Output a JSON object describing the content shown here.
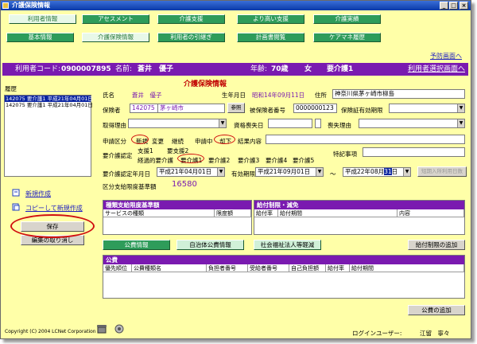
{
  "window": {
    "title": "介護保険情報"
  },
  "nav_row1": [
    "利用者情報",
    "アセスメント",
    "介護支援",
    "より高い支援",
    "介護実績"
  ],
  "nav_row2": [
    "基本情報",
    "介護保険情報",
    "利用者の引継ぎ",
    "計画書閲覧",
    "ケアマネ履歴"
  ],
  "links": {
    "prev_screen": "予防画面へ",
    "user_select": "利用者選択画面へ",
    "new_create": "新規作成",
    "copy_create": "コピーして新規作成"
  },
  "userbar": {
    "code_label": "利用者コード:",
    "code": "0900007895",
    "name_label": "名前:",
    "name": "蒼井　優子",
    "age_label": "年齢:",
    "age": "70歳",
    "sex": "女",
    "care_level": "要介護1"
  },
  "history": {
    "label": "履歴",
    "items": [
      "142075 要介護1 平成21年04月01日",
      "142075 要介護1 平成21年04月01日"
    ]
  },
  "form": {
    "section_title": "介護保険情報",
    "name_label": "氏名",
    "name_value": "蒼井　優子",
    "birth_label": "生年月日",
    "birth_value": "昭和14年09月11日",
    "address_label": "住所",
    "address_value": "神奈川県茅ヶ崎市柳島",
    "insurer_label": "保険者",
    "insurer_code": "142075",
    "insurer_name": "茅ヶ崎市",
    "ref_button": "参照",
    "insured_no_label": "被保険者番号",
    "insured_no": "0000000123",
    "validity_label": "保険証有効期限",
    "acquire_reason_label": "取得理由",
    "lose_date_label": "資格喪失日",
    "lose_reason_label": "喪失理由",
    "apply_label": "申請区分",
    "apply_options": [
      "新規",
      "変更",
      "継続",
      "申請中",
      "却下",
      "結果内容"
    ],
    "level_label": "要介護認定",
    "level_row1": [
      "支援1",
      "要支援2"
    ],
    "level_row2": [
      "経過的要介護",
      "要介護1",
      "要介護2",
      "要介護3",
      "要介護4",
      "要介護5"
    ],
    "special_label": "特記事項",
    "cert_date_label": "要介護認定年月日",
    "cert_date": "平成21年04月01日",
    "valid_label": "有効期限",
    "valid_from": "平成21年09月01日",
    "tilde": "～",
    "valid_to_prefix": "平成22年08月",
    "valid_to_day": "31",
    "valid_to_suffix": "日",
    "short_term_button": "短期入所利用日数",
    "limit_label": "区分支給限度基準額",
    "limit_value": "16580"
  },
  "panel_limits": {
    "title": "種類支給限度基準額",
    "cols": [
      "サービスの種類",
      "限度額"
    ]
  },
  "panel_benefit": {
    "title": "給付制限・減免",
    "cols": [
      "給付率",
      "給付期間",
      "内容"
    ]
  },
  "buttons": {
    "save": "保存",
    "cancel_edit": "編集の取り消し",
    "public_info": "公費情報",
    "local_info": "自治体公費情報",
    "welfare": "社会福祉法人等軽減",
    "add_benefit": "給付制限の追加",
    "add_public": "公費の追加"
  },
  "panel_public": {
    "title": "公費",
    "cols": [
      "優先順位",
      "公費種類名",
      "負担者番号",
      "受給者番号",
      "自己負担額",
      "給付率",
      "給付期間"
    ]
  },
  "footer": {
    "copyright": "Copyright (C) 2004 LCNet Corporation",
    "login_label": "ログインユーザー:",
    "login_user": "江留　寧々"
  }
}
